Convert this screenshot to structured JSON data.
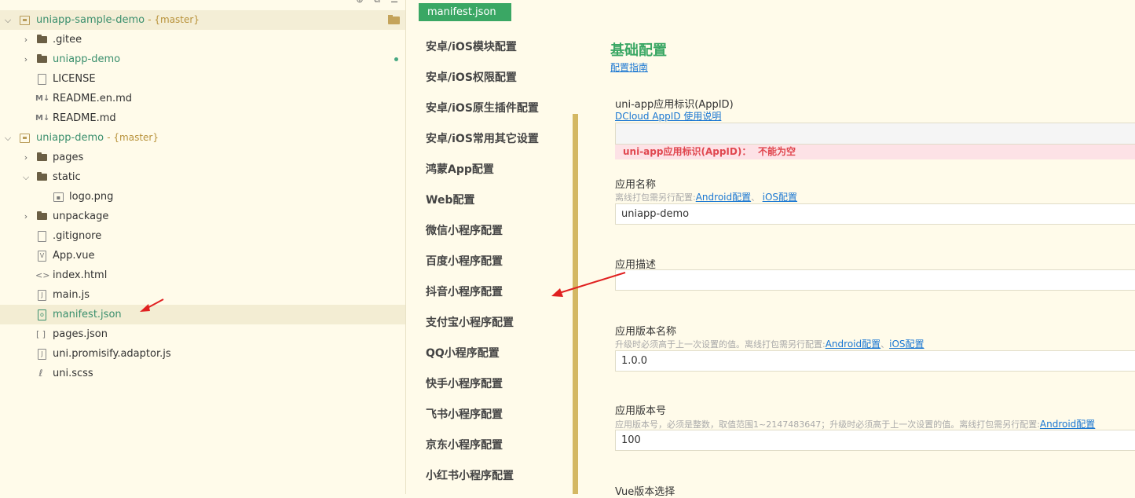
{
  "explorer": {
    "toolbar": [
      "add-icon",
      "copy-icon",
      "menu-icon"
    ],
    "rows": [
      {
        "kind": "root",
        "name": "uniapp-sample-demo",
        "branch": "- {master}"
      },
      {
        "kind": "folder",
        "name": ".gitee"
      },
      {
        "kind": "folder",
        "name": "uniapp-demo"
      },
      {
        "kind": "file",
        "name": "LICENSE"
      },
      {
        "kind": "md",
        "name": "README.en.md"
      },
      {
        "kind": "md",
        "name": "README.md"
      },
      {
        "kind": "root",
        "name": "uniapp-demo",
        "branch": "- {master}"
      },
      {
        "kind": "folder",
        "name": "pages"
      },
      {
        "kind": "folder",
        "name": "static"
      },
      {
        "kind": "image",
        "name": "logo.png"
      },
      {
        "kind": "folder",
        "name": "unpackage"
      },
      {
        "kind": "file",
        "name": ".gitignore"
      },
      {
        "kind": "vue",
        "name": "App.vue"
      },
      {
        "kind": "html",
        "name": "index.html"
      },
      {
        "kind": "js",
        "name": "main.js"
      },
      {
        "kind": "json",
        "name": "manifest.json"
      },
      {
        "kind": "json",
        "name": "pages.json"
      },
      {
        "kind": "js",
        "name": "uni.promisify.adaptor.js"
      },
      {
        "kind": "scss",
        "name": "uni.scss"
      }
    ]
  },
  "tab": {
    "label": "manifest.json"
  },
  "nav": {
    "items": [
      "安卓/iOS模块配置",
      "安卓/iOS权限配置",
      "安卓/iOS原生插件配置",
      "安卓/iOS常用其它设置",
      "鸿蒙App配置",
      "Web配置",
      "微信小程序配置",
      "百度小程序配置",
      "抖音小程序配置",
      "支付宝小程序配置",
      "QQ小程序配置",
      "快手小程序配置",
      "飞书小程序配置",
      "京东小程序配置",
      "小红书小程序配置"
    ]
  },
  "content": {
    "title": "基础配置",
    "guide_link": "配置指南",
    "appid": {
      "label": "uni-app应用标识(AppID)",
      "link": "DCloud AppID 使用说明",
      "value": "",
      "error_label": "uni-app应用标识(AppID)：",
      "error_msg": "不能为空"
    },
    "app_name": {
      "label": "应用名称",
      "hint": "离线打包需另行配置:",
      "android_link": "Android配置",
      "sep": "、",
      "ios_link": "iOS配置",
      "value": "uniapp-demo"
    },
    "app_desc": {
      "label": "应用描述",
      "value": ""
    },
    "version_name": {
      "label": "应用版本名称",
      "hint": "升级时必须高于上一次设置的值。离线打包需另行配置:",
      "android_link": "Android配置",
      "sep": "、",
      "ios_link": "iOS配置",
      "value": "1.0.0"
    },
    "version_code": {
      "label": "应用版本号",
      "hint": "应用版本号，必须是整数，取值范围1~2147483647；升级时必须高于上一次设置的值。离线打包需另行配置:",
      "android_link": "Android配置",
      "value": "100"
    },
    "vue_version": {
      "label": "Vue版本选择"
    }
  },
  "colors": {
    "accent": "#3aa764",
    "link": "#1976d2",
    "error": "#e0474f",
    "arrow": "#e02020"
  }
}
